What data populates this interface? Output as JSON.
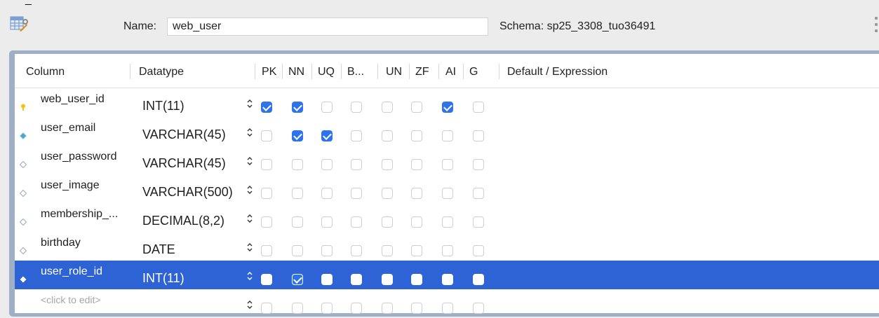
{
  "header": {
    "clipped_text": "_",
    "name_label": "Name:",
    "name_value": "web_user",
    "schema_label": "Schema: sp25_3308_tuo36491"
  },
  "columns_header": {
    "column": "Column",
    "datatype": "Datatype",
    "pk": "PK",
    "nn": "NN",
    "uq": "UQ",
    "b": "B...",
    "un": "UN",
    "zf": "ZF",
    "ai": "AI",
    "g": "G",
    "default": "Default / Expression"
  },
  "rows": [
    {
      "name": "web_user_id",
      "type": "INT(11)",
      "icon": "primary-key-icon",
      "flags": [
        true,
        true,
        false,
        false,
        false,
        false,
        true,
        false
      ]
    },
    {
      "name": "user_email",
      "type": "VARCHAR(45)",
      "icon": "column-diamond-filled-icon",
      "flags": [
        false,
        true,
        true,
        false,
        false,
        false,
        false,
        false
      ]
    },
    {
      "name": "user_password",
      "type": "VARCHAR(45)",
      "icon": "column-diamond-icon",
      "flags": [
        false,
        false,
        false,
        false,
        false,
        false,
        false,
        false
      ]
    },
    {
      "name": "user_image",
      "type": "VARCHAR(500)",
      "icon": "column-diamond-icon",
      "flags": [
        false,
        false,
        false,
        false,
        false,
        false,
        false,
        false
      ]
    },
    {
      "name": "membership_...",
      "type": "DECIMAL(8,2)",
      "icon": "column-diamond-icon",
      "flags": [
        false,
        false,
        false,
        false,
        false,
        false,
        false,
        false
      ]
    },
    {
      "name": "birthday",
      "type": "DATE",
      "icon": "column-diamond-icon",
      "flags": [
        false,
        false,
        false,
        false,
        false,
        false,
        false,
        false
      ]
    },
    {
      "name": "user_role_id",
      "type": "INT(11)",
      "icon": "column-diamond-filled-icon",
      "selected": true,
      "flags": [
        false,
        true,
        false,
        false,
        false,
        false,
        false,
        false
      ]
    },
    {
      "name": "<click to edit>",
      "type": "",
      "icon": "",
      "placeholder": true,
      "flags": [
        false,
        false,
        false,
        false,
        false,
        false,
        false,
        false
      ]
    }
  ],
  "colors": {
    "selection": "#2e63d6",
    "checkbox_checked": "#2f73ea",
    "key_icon": "#f0c419",
    "diamond_filled": "#4aa8c8",
    "frame": "#9fb0c6"
  },
  "arrow_glyph": "⌃⌄"
}
